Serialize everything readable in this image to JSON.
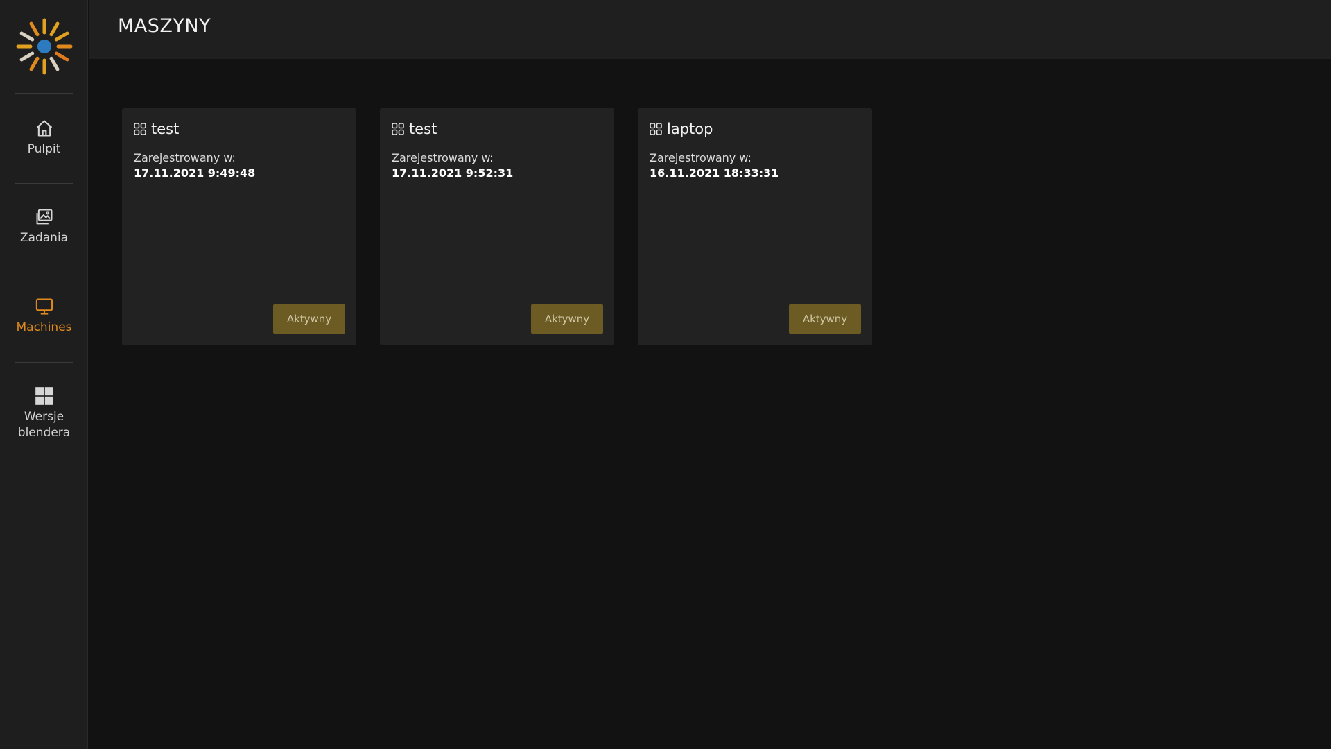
{
  "header": {
    "title": "MASZYNY"
  },
  "sidebar": {
    "items": [
      {
        "label": "Pulpit",
        "icon": "home-icon"
      },
      {
        "label": "Zadania",
        "icon": "images-icon"
      },
      {
        "label": "Machines",
        "icon": "monitor-icon",
        "active": true
      },
      {
        "label": "Wersje blendera",
        "icon": "windows-icon"
      }
    ]
  },
  "colors": {
    "accent": "#e08a1e",
    "logo_center": "#2c7bc0",
    "status_button": "#6c5c24"
  },
  "machines": [
    {
      "name": "test",
      "registered_label": "Zarejestrowany w:",
      "registered_at": "17.11.2021 9:49:48",
      "status": "Aktywny"
    },
    {
      "name": "test",
      "registered_label": "Zarejestrowany w:",
      "registered_at": "17.11.2021 9:52:31",
      "status": "Aktywny"
    },
    {
      "name": "laptop",
      "registered_label": "Zarejestrowany w:",
      "registered_at": "16.11.2021 18:33:31",
      "status": "Aktywny"
    }
  ]
}
